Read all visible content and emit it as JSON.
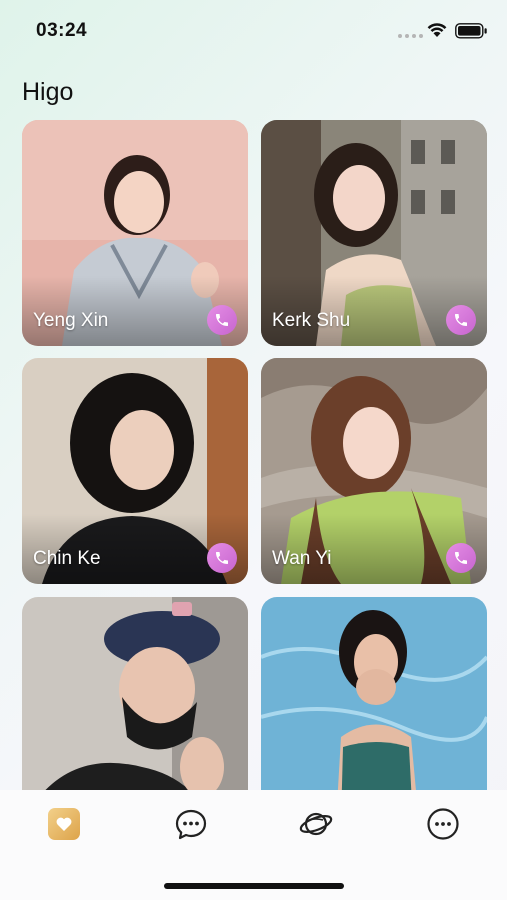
{
  "status": {
    "time": "03:24"
  },
  "app": {
    "title": "Higo"
  },
  "cards": [
    {
      "name": "Yeng Xin"
    },
    {
      "name": "Kerk Shu"
    },
    {
      "name": "Chin Ke"
    },
    {
      "name": "Wan Yi"
    },
    {
      "name": ""
    },
    {
      "name": ""
    }
  ],
  "tabs": [
    {
      "icon": "heart-icon",
      "active": true
    },
    {
      "icon": "chat-bubble-icon",
      "active": false
    },
    {
      "icon": "planet-icon",
      "active": false
    },
    {
      "icon": "more-circle-icon",
      "active": false
    }
  ],
  "colors": {
    "accent": "#d57ad9",
    "tab_active": "#e8b85a"
  }
}
